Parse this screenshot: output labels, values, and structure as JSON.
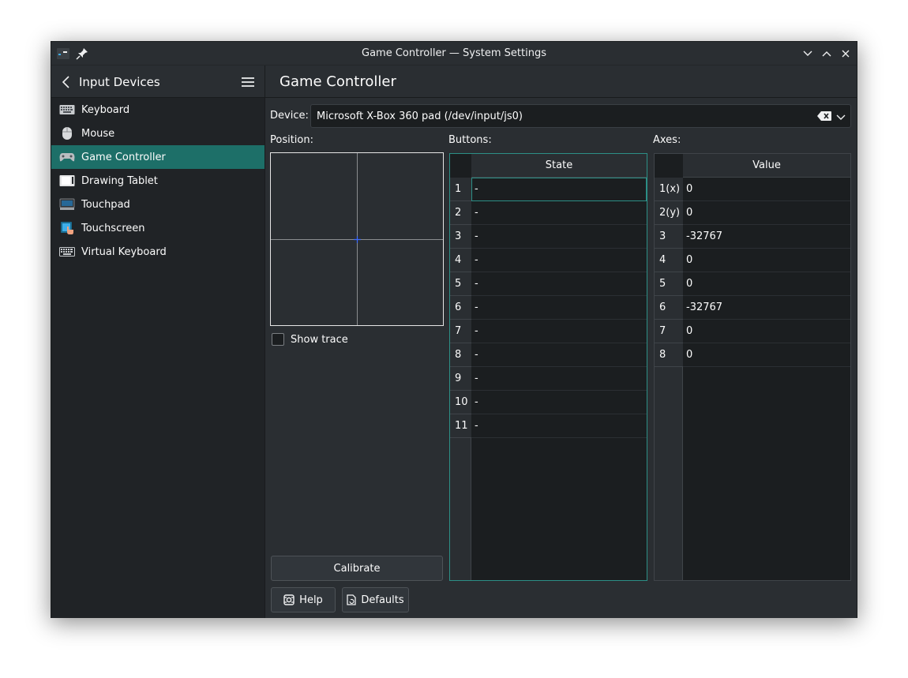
{
  "window": {
    "title": "Game Controller — System Settings"
  },
  "sidebar": {
    "header": "Input Devices",
    "items": [
      {
        "label": "Keyboard",
        "icon": "keyboard-icon",
        "active": false
      },
      {
        "label": "Mouse",
        "icon": "mouse-icon",
        "active": false
      },
      {
        "label": "Game Controller",
        "icon": "gamepad-icon",
        "active": true
      },
      {
        "label": "Drawing Tablet",
        "icon": "tablet-icon",
        "active": false
      },
      {
        "label": "Touchpad",
        "icon": "touchpad-icon",
        "active": false
      },
      {
        "label": "Touchscreen",
        "icon": "touchscreen-icon",
        "active": false
      },
      {
        "label": "Virtual Keyboard",
        "icon": "virtual-keyboard-icon",
        "active": false
      }
    ]
  },
  "main": {
    "title": "Game Controller",
    "device_label": "Device:",
    "device_value": "Microsoft X-Box 360 pad (/dev/input/js0)",
    "position_label": "Position:",
    "buttons_label": "Buttons:",
    "axes_label": "Axes:",
    "show_trace_label": "Show trace",
    "show_trace_checked": false,
    "calibrate_label": "Calibrate",
    "help_label": "Help",
    "defaults_label": "Defaults"
  },
  "buttons_table": {
    "header": "State",
    "rows": [
      {
        "num": "1",
        "state": "-"
      },
      {
        "num": "2",
        "state": "-"
      },
      {
        "num": "3",
        "state": "-"
      },
      {
        "num": "4",
        "state": "-"
      },
      {
        "num": "5",
        "state": "-"
      },
      {
        "num": "6",
        "state": "-"
      },
      {
        "num": "7",
        "state": "-"
      },
      {
        "num": "8",
        "state": "-"
      },
      {
        "num": "9",
        "state": "-"
      },
      {
        "num": "10",
        "state": "-"
      },
      {
        "num": "11",
        "state": "-"
      }
    ]
  },
  "axes_table": {
    "header": "Value",
    "rows": [
      {
        "num": "1(x)",
        "value": "0"
      },
      {
        "num": "2(y)",
        "value": "0"
      },
      {
        "num": "3",
        "value": "-32767"
      },
      {
        "num": "4",
        "value": "0"
      },
      {
        "num": "5",
        "value": "0"
      },
      {
        "num": "6",
        "value": "-32767"
      },
      {
        "num": "7",
        "value": "0"
      },
      {
        "num": "8",
        "value": "0"
      }
    ]
  },
  "colors": {
    "accent": "#1d6f68",
    "focus_border": "#2c8f86",
    "background": "#2a2e32",
    "view": "#1b1e20"
  }
}
